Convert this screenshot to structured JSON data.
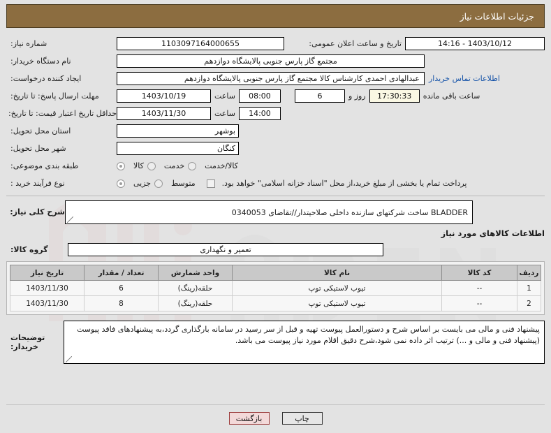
{
  "header": {
    "title": "جزئیات اطلاعات نیاز"
  },
  "fields": {
    "need_number_label": "شماره نیاز:",
    "need_number_value": "1103097164000655",
    "announce_label": "تاریخ و ساعت اعلان عمومی:",
    "announce_value": "1403/10/12 - 14:16",
    "buyer_org_label": "نام دستگاه خریدار:",
    "buyer_org_value": "مجتمع گاز پارس جنوبی  پالایشگاه دوازدهم",
    "requester_label": "ایجاد کننده درخواست:",
    "requester_value": "عبدالهادی احمدی کارشناس کالا مجتمع گاز پارس جنوبی  پالایشگاه دوازدهم",
    "contact_link": "اطلاعات تماس خریدار",
    "response_deadline_label": "مهلت ارسال پاسخ: تا تاریخ:",
    "response_deadline_date": "1403/10/19",
    "hour_label": "ساعت",
    "response_deadline_time": "08:00",
    "days_remaining": "6",
    "days_label": "روز و",
    "time_remaining": "17:30:33",
    "time_remaining_label": "ساعت باقی مانده",
    "price_validity_label": "حداقل تاریخ اعتبار قیمت: تا تاریخ:",
    "price_validity_date": "1403/11/30",
    "price_validity_time": "14:00",
    "province_label": "استان محل تحویل:",
    "province_value": "بوشهر",
    "city_label": "شهر محل تحویل:",
    "city_value": "کنگان",
    "category_label": "طبقه بندی موضوعی:",
    "category_options": [
      "کالا",
      "خدمت",
      "کالا/خدمت"
    ],
    "category_selected": "کالا",
    "process_label": "نوع فرآیند خرید :",
    "process_options": [
      "جزیی",
      "متوسط"
    ],
    "process_selected": "جزیی",
    "treasury_checkbox_text": "پرداخت تمام یا بخشی از مبلغ خرید،از محل \"اسناد خزانه اسلامی\" خواهد بود.",
    "treasury_checked": false,
    "general_desc_label": "شرح کلی نیاز:",
    "general_desc_value": "BLADDER ساخت شرکتهای سازنده داخلی صلاحیتدار//تقاضای 0340053"
  },
  "goods_section": {
    "title": "اطلاعات کالاهای مورد نیاز",
    "group_label": "گروه کالا:",
    "group_value": "تعمیر و نگهداری",
    "columns": [
      "ردیف",
      "کد کالا",
      "نام کالا",
      "واحد شمارش",
      "تعداد / مقدار",
      "تاریخ نیاز"
    ],
    "rows": [
      {
        "row": "1",
        "code": "--",
        "name": "تیوب لاستیکی توپ",
        "unit": "حلقه(رینگ)",
        "qty": "6",
        "date": "1403/11/30"
      },
      {
        "row": "2",
        "code": "--",
        "name": "تیوب لاستیکی توپ",
        "unit": "حلقه(رینگ)",
        "qty": "8",
        "date": "1403/11/30"
      }
    ]
  },
  "notes": {
    "label": "توضیحات خریدار:",
    "value": "پیشنهاد فنی و مالی می بایست بر اساس شرح و دستورالعمل پیوست تهیه و قبل از سر رسید در سامانه بارگذاری گردد،به پیشنهادهای فاقد پیوست (پیشنهاد فنی و مالی و ...) ترتیب اثر داده نمی شود،شرح دقیق اقلام مورد نیاز پیوست می باشد."
  },
  "buttons": {
    "back": "بازگشت",
    "print": "چاپ"
  },
  "colors": {
    "header_bg": "#8c6d40",
    "link": "#1452a8",
    "back_btn": "#f3d9d9"
  }
}
